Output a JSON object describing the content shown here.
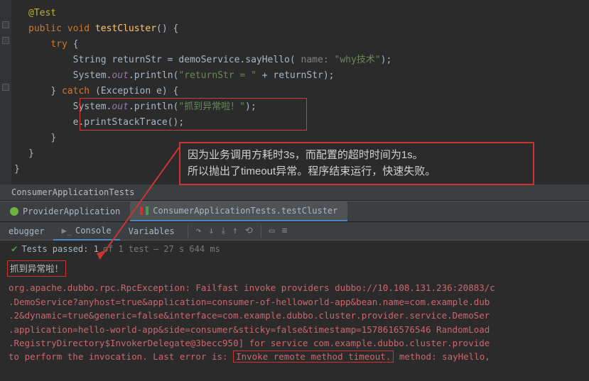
{
  "code": {
    "annotation": "@Test",
    "sig_kw1": "public ",
    "sig_kw2": "void ",
    "sig_name": "testCluster",
    "sig_paren": "() {",
    "try_kw": "try ",
    "try_open": "{",
    "l1_a": "String returnStr = demoService.sayHello(",
    "l1_param": " name: ",
    "l1_str": "\"why技术\"",
    "l1_end": ");",
    "l2_a": "System.",
    "l2_out": "out",
    "l2_b": ".println(",
    "l2_str": "\"returnStr = \"",
    "l2_c": " + returnStr);",
    "catch_kw": "} ",
    "catch_kw2": "catch ",
    "catch_sig": "(Exception e) {",
    "l3_a": "System.",
    "l3_out": "out",
    "l3_b": ".println(",
    "l3_str": "\"抓到异常啦！\"",
    "l3_end": ");",
    "l4": "e.printStackTrace();",
    "close1": "}",
    "close2": "}",
    "close3": "}"
  },
  "annotation": {
    "line1": "因为业务调用方耗时3s，而配置的超时时间为1s。",
    "line2": "所以抛出了timeout异常。程序结束运行，快速失败。"
  },
  "breadcrumb": "ConsumerApplicationTests",
  "runTabs": {
    "provider": "ProviderApplication",
    "consumer": "ConsumerApplicationTests.testCluster"
  },
  "debugTabs": {
    "debugger": "ebugger",
    "console": "Console",
    "variables": "Variables"
  },
  "testStatus": {
    "passed": "Tests passed: 1",
    "of": " of 1 test",
    "time": " – 27 s 644 ms"
  },
  "console": {
    "caught": "抓到异常啦！",
    "l1": "org.apache.dubbo.rpc.RpcException: Failfast invoke providers dubbo://10.108.131.236:20883/c",
    "l2": "    .DemoService?anyhost=true&application=consumer-of-helloworld-app&bean.name=com.example.dub",
    "l3": "    .2&dynamic=true&generic=false&interface=com.example.dubbo.cluster.provider.service.DemoSer",
    "l4": "    .application=hello-world-app&side=consumer&sticky=false&timestamp=1578616576546 RandomLoad",
    "l5a": "    .RegistryDirectory$InvokerDelegate@3becc950] for service com.example.dubbo.cluster.provide",
    "l6a": "    to perform the invocation. Last error is: ",
    "l6box": "Invoke remote method timeout.",
    "l6b": " method: sayHello,"
  }
}
